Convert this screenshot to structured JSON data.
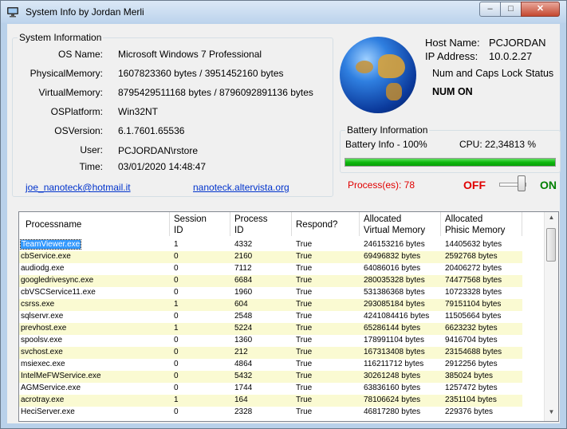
{
  "window": {
    "title": "System Info by Jordan Merli",
    "min_glyph": "–",
    "max_glyph": "□",
    "close_glyph": "✕"
  },
  "sysinfo": {
    "group_title": "System Information",
    "os_name_label": "OS Name:",
    "os_name": "Microsoft Windows 7 Professional",
    "phys_label": "PhysicalMemory:",
    "phys": "1607823360 bytes / 3951452160 bytes",
    "virt_label": "VirtualMemory:",
    "virt": "8795429511168 bytes / 8796092891136 bytes",
    "platform_label": "OSPlatform:",
    "platform": "Win32NT",
    "version_label": "OSVersion:",
    "version": "6.1.7601.65536",
    "user_label": "User:",
    "user": "PCJORDAN\\rstore",
    "time_label": "Time:",
    "time": "03/01/2020 14:48:47",
    "email": "joe_nanoteck@hotmail.it",
    "website": "nanoteck.altervista.org"
  },
  "host": {
    "name_label": "Host Name:",
    "name": "PCJORDAN",
    "ip_label": "IP Address:",
    "ip": "10.0.2.27",
    "lock_title": "Num and Caps Lock Status",
    "lock_status": "NUM ON"
  },
  "battery": {
    "group_title": "Battery Information",
    "info": "Battery Info - 100%",
    "cpu": "CPU: 22,34813 %",
    "level_percent": 100
  },
  "process_count": "Process(es): 78",
  "toggle": {
    "off": "OFF",
    "on": "ON"
  },
  "colors": {
    "off": "#e00000",
    "on": "#008000",
    "process_count": "#e00000",
    "alt_row": "#fafad2",
    "selected": "#3399ff"
  },
  "table": {
    "headers": [
      [
        "Processname"
      ],
      [
        "Session",
        "ID"
      ],
      [
        "Process",
        "ID"
      ],
      [
        "Respond?"
      ],
      [
        "Allocated",
        "Virtual Memory"
      ],
      [
        "Allocated",
        "Phisic Memory"
      ]
    ],
    "rows": [
      [
        "TeamViewer.exe",
        "1",
        "4332",
        "True",
        "246153216 bytes",
        "14405632 bytes"
      ],
      [
        "cbService.exe",
        "0",
        "2160",
        "True",
        "69496832 bytes",
        "2592768 bytes"
      ],
      [
        "audiodg.exe",
        "0",
        "7112",
        "True",
        "64086016 bytes",
        "20406272 bytes"
      ],
      [
        "googledrivesync.exe",
        "0",
        "6684",
        "True",
        "280035328 bytes",
        "74477568 bytes"
      ],
      [
        "cbVSCService11.exe",
        "0",
        "1960",
        "True",
        "531386368 bytes",
        "10723328 bytes"
      ],
      [
        "csrss.exe",
        "1",
        "604",
        "True",
        "293085184 bytes",
        "79151104 bytes"
      ],
      [
        "sqlservr.exe",
        "0",
        "2548",
        "True",
        "4241084416 bytes",
        "11505664 bytes"
      ],
      [
        "prevhost.exe",
        "1",
        "5224",
        "True",
        "65286144 bytes",
        "6623232 bytes"
      ],
      [
        "spoolsv.exe",
        "0",
        "1360",
        "True",
        "178991104 bytes",
        "9416704 bytes"
      ],
      [
        "svchost.exe",
        "0",
        "212",
        "True",
        "167313408 bytes",
        "23154688 bytes"
      ],
      [
        "msiexec.exe",
        "0",
        "4864",
        "True",
        "116211712 bytes",
        "2912256 bytes"
      ],
      [
        "IntelMeFWService.exe",
        "0",
        "5432",
        "True",
        "30261248 bytes",
        "385024 bytes"
      ],
      [
        "AGMService.exe",
        "0",
        "1744",
        "True",
        "63836160 bytes",
        "1257472 bytes"
      ],
      [
        "acrotray.exe",
        "1",
        "164",
        "True",
        "78106624 bytes",
        "2351104 bytes"
      ],
      [
        "HeciServer.exe",
        "0",
        "2328",
        "True",
        "46817280 bytes",
        "229376 bytes"
      ]
    ],
    "selected_row": 0
  },
  "scroll": {
    "up_glyph": "▲",
    "down_glyph": "▼"
  }
}
